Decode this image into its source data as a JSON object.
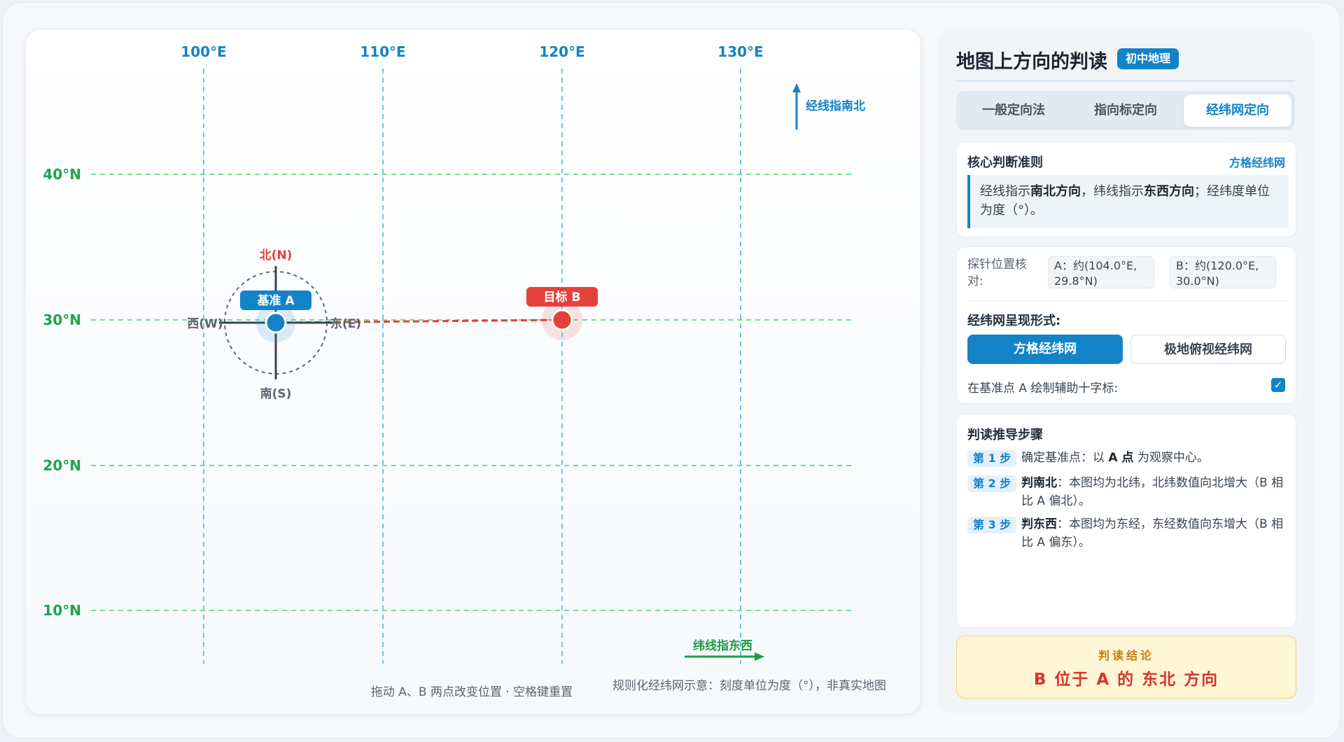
{
  "map": {
    "lon_labels": [
      "100°E",
      "110°E",
      "120°E",
      "130°E"
    ],
    "lat_labels": [
      "40°N",
      "30°N",
      "20°N",
      "10°N"
    ],
    "north_annotation": "经线指南北",
    "east_annotation": "纬线指东西",
    "point_a": {
      "tag": "基准 A",
      "lon": 104.0,
      "lat": 29.8
    },
    "point_b": {
      "tag": "目标 B",
      "lon": 120.0,
      "lat": 30.0
    },
    "compass": {
      "north": "北(N)",
      "south": "南(S)",
      "west": "西(W)",
      "east": "东(E)"
    },
    "hint": "拖动 A、B 两点改变位置 · 空格键重置",
    "caption": "规则化经纬网示意：刻度单位为度（°），非真实地图",
    "colors": {
      "longitude": "#1583c6",
      "latitude": "#1ea34a",
      "point_a": "#1383c7",
      "point_b": "#e5403b"
    }
  },
  "panel": {
    "title": "地图上方向的判读",
    "badge": "初中地理",
    "tabs": [
      "一般定向法",
      "指向标定向",
      "经纬网定向"
    ],
    "active_tab": "经纬网定向",
    "core": {
      "heading": "核心判断准则",
      "link": "方格经纬网",
      "t1": "经线指示",
      "b1": "南北方向",
      "t2": "，纬线指示",
      "b2": "东西方向",
      "t3": "；经纬度单位为度（°）。"
    },
    "probe": {
      "label": "探针位置核对:",
      "a_value": "A：约(104.0°E, 29.8°N)",
      "b_value": "B：约(120.0°E, 30.0°N)"
    },
    "form_heading": "经纬网呈现形式:",
    "form_options": [
      "方格经纬网",
      "极地俯视经纬网"
    ],
    "form_selected": "方格经纬网",
    "crosshair_label": "在基准点 A 绘制辅助十字标:",
    "crosshair_checked": true,
    "steps_heading": "判读推导步骤",
    "steps": [
      {
        "badge": "第 1 步",
        "pre": "确定基准点：以 ",
        "bold": "A 点",
        "post": " 为观察中心。"
      },
      {
        "badge": "第 2 步",
        "pre": "",
        "bold": "判南北",
        "post": "：本图均为北纬，北纬数值向北增大（B 相比 A 偏北）。"
      },
      {
        "badge": "第 3 步",
        "pre": "",
        "bold": "判东西",
        "post": "：本图均为东经，东经数值向东增大（B 相比 A 偏东）。"
      }
    ],
    "result_label": "判读结论",
    "result_text": "B 位于 A 的 东北 方向"
  }
}
